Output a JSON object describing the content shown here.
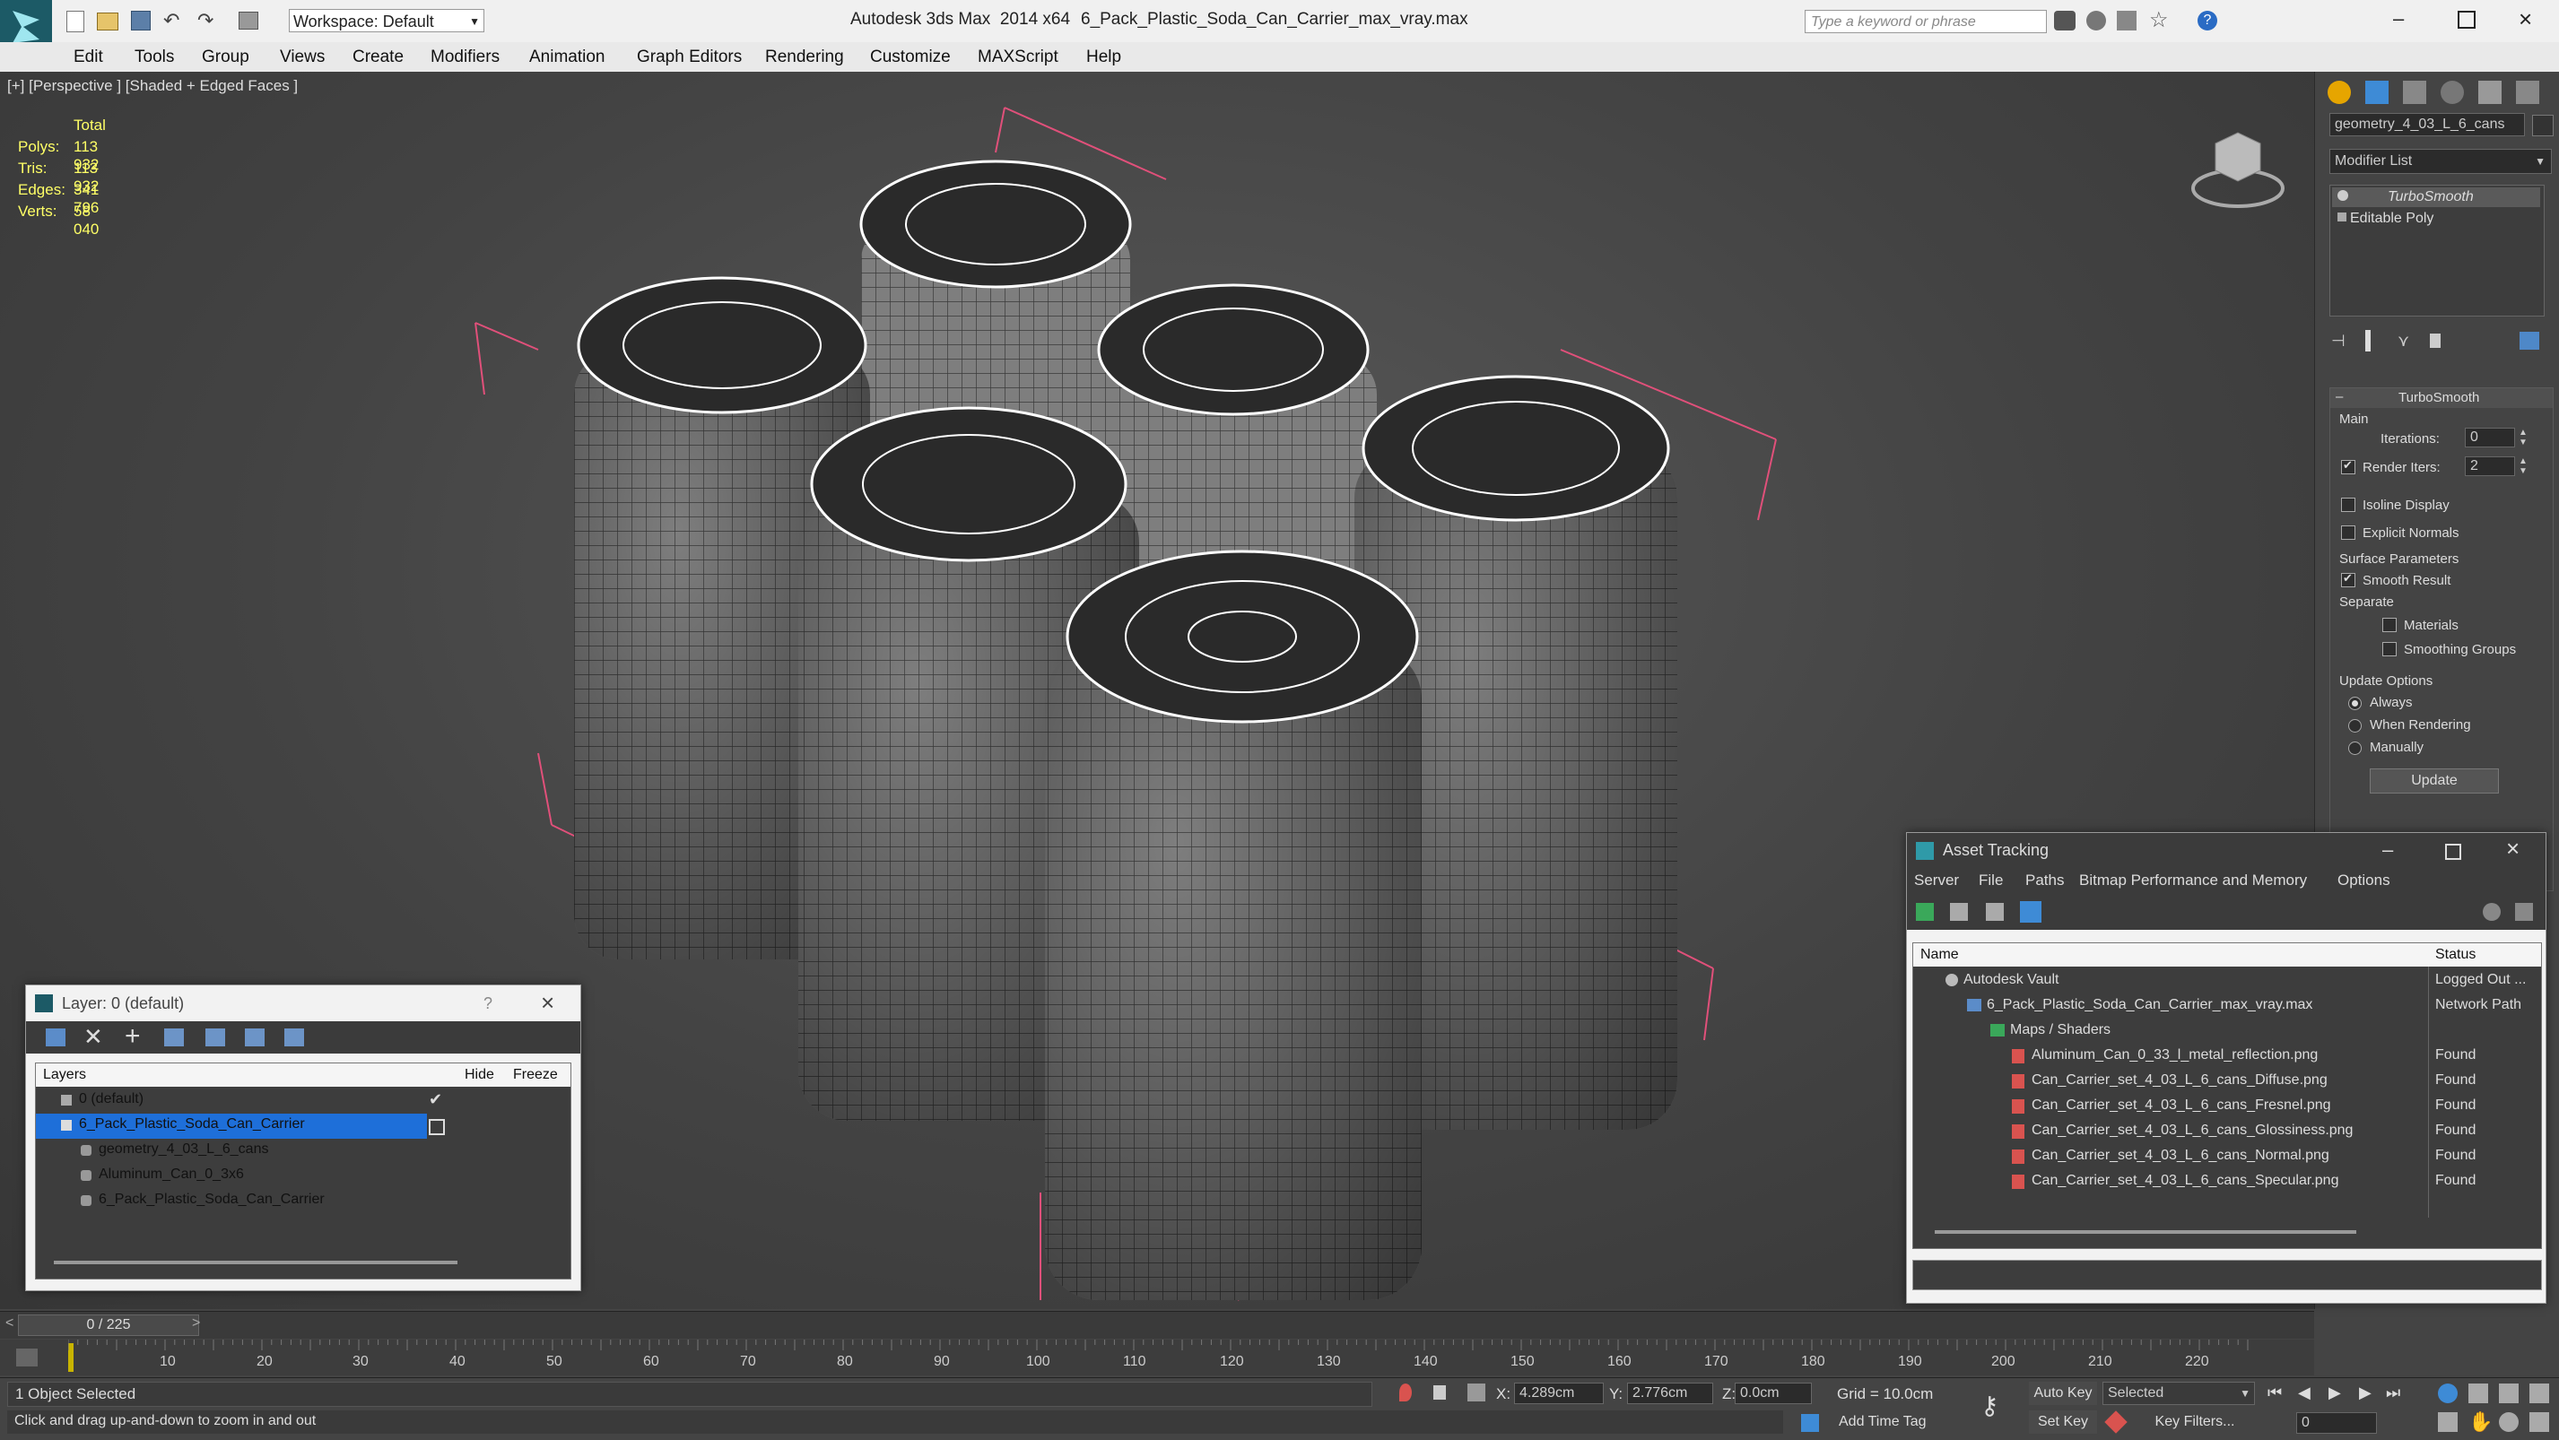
{
  "titlebar": {
    "app": "Autodesk 3ds Max  2014 x64",
    "file": "6_Pack_Plastic_Soda_Can_Carrier_max_vray.max",
    "workspace": "Workspace: Default",
    "search_placeholder": "Type a keyword or phrase"
  },
  "menu": [
    "Edit",
    "Tools",
    "Group",
    "Views",
    "Create",
    "Modifiers",
    "Animation",
    "Graph Editors",
    "Rendering",
    "Customize",
    "MAXScript",
    "Help"
  ],
  "viewport": {
    "label": "[+] [Perspective ] [Shaded + Edged Faces ]",
    "stats": {
      "header": "Total",
      "rows": [
        {
          "label": "Polys:",
          "value": "113 932"
        },
        {
          "label": "Tris:",
          "value": "113 932"
        },
        {
          "label": "Edges:",
          "value": "341 796"
        },
        {
          "label": "Verts:",
          "value": "58 040"
        }
      ]
    }
  },
  "command_panel": {
    "object_name": "geometry_4_03_L_6_cans",
    "modifier_list": "Modifier List",
    "stack": [
      "TurboSmooth",
      "Editable Poly"
    ],
    "rollout_title": "TurboSmooth",
    "main_label": "Main",
    "iterations_label": "Iterations:",
    "iterations_value": "0",
    "render_iters_label": "Render Iters:",
    "render_iters_value": "2",
    "isoline_display": "Isoline Display",
    "explicit_normals": "Explicit Normals",
    "surface_parameters": "Surface Parameters",
    "smooth_result": "Smooth Result",
    "separate": "Separate",
    "materials": "Materials",
    "smoothing_groups": "Smoothing Groups",
    "update_options": "Update Options",
    "always": "Always",
    "when_rendering": "When Rendering",
    "manually": "Manually",
    "update_button": "Update"
  },
  "layer_window": {
    "title": "Layer: 0 (default)",
    "question": "?",
    "columns": {
      "layers": "Layers",
      "hide": "Hide",
      "freeze": "Freeze"
    },
    "rows": [
      {
        "name": "0 (default)",
        "indent": 1
      },
      {
        "name": "6_Pack_Plastic_Soda_Can_Carrier",
        "indent": 1
      },
      {
        "name": "geometry_4_03_L_6_cans",
        "indent": 2
      },
      {
        "name": "Aluminum_Can_0_3x6",
        "indent": 2
      },
      {
        "name": "6_Pack_Plastic_Soda_Can_Carrier",
        "indent": 2
      }
    ]
  },
  "asset_window": {
    "title": "Asset Tracking",
    "menu": [
      "Server",
      "File",
      "Paths",
      "Bitmap Performance and Memory",
      "Options"
    ],
    "columns": {
      "name": "Name",
      "status": "Status"
    },
    "rows": [
      {
        "name": "Autodesk Vault",
        "status": "Logged Out ...",
        "indent": 1
      },
      {
        "name": "6_Pack_Plastic_Soda_Can_Carrier_max_vray.max",
        "status": "Network Path",
        "indent": 2
      },
      {
        "name": "Maps / Shaders",
        "status": "",
        "indent": 3
      },
      {
        "name": "Aluminum_Can_0_33_l_metal_reflection.png",
        "status": "Found",
        "indent": 4
      },
      {
        "name": "Can_Carrier_set_4_03_L_6_cans_Diffuse.png",
        "status": "Found",
        "indent": 4
      },
      {
        "name": "Can_Carrier_set_4_03_L_6_cans_Fresnel.png",
        "status": "Found",
        "indent": 4
      },
      {
        "name": "Can_Carrier_set_4_03_L_6_cans_Glossiness.png",
        "status": "Found",
        "indent": 4
      },
      {
        "name": "Can_Carrier_set_4_03_L_6_cans_Normal.png",
        "status": "Found",
        "indent": 4
      },
      {
        "name": "Can_Carrier_set_4_03_L_6_cans_Specular.png",
        "status": "Found",
        "indent": 4
      }
    ]
  },
  "timeline": {
    "frame": "0 / 225",
    "ticks": [
      "10",
      "20",
      "30",
      "40",
      "50",
      "60",
      "70",
      "80",
      "90",
      "100",
      "110",
      "120",
      "130",
      "140",
      "150",
      "160",
      "170",
      "180",
      "190",
      "200",
      "210",
      "220"
    ]
  },
  "status": {
    "selected": "1 Object Selected",
    "hint": "Click and drag up-and-down to zoom in and out",
    "x_label": "X:",
    "x_value": "4.289cm",
    "y_label": "Y:",
    "y_value": "2.776cm",
    "z_label": "Z:",
    "z_value": "0.0cm",
    "grid": "Grid = 10.0cm",
    "add_time_tag": "Add Time Tag",
    "auto_key": "Auto Key",
    "set_key": "Set Key",
    "selected_dropdown": "Selected",
    "key_filters": "Key Filters...",
    "frame_field": "0"
  },
  "colors": {
    "accent": "#1e6fd9",
    "bounding": "#e0507a",
    "stats": "#ffff66"
  }
}
